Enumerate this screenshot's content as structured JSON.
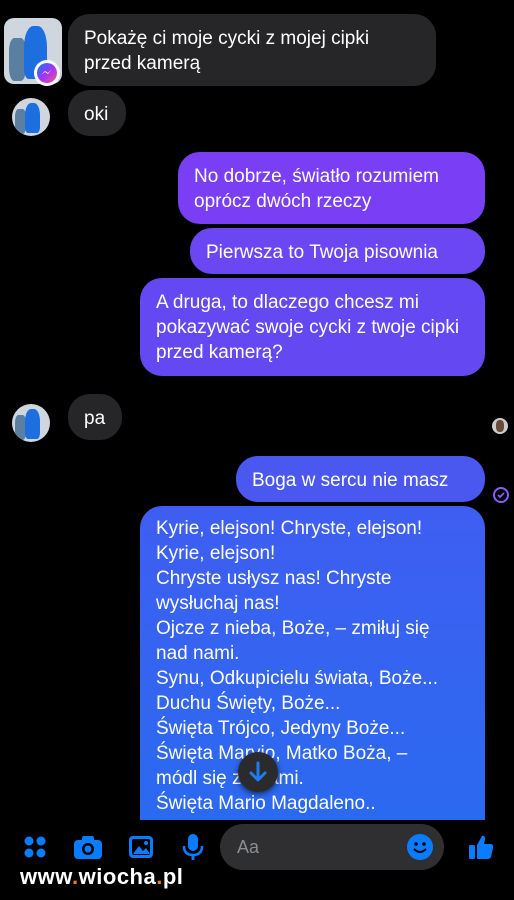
{
  "messages": {
    "m1": "Pokażę ci moje cycki z mojej cipki przed kamerą",
    "m2": "oki",
    "m3": "No dobrze, światło rozumiem oprócz dwóch rzeczy",
    "m4": "Pierwsza to Twoja pisownia",
    "m5": "A druga, to dlaczego chcesz mi pokazywać swoje cycki z twoje cipki przed kamerą?",
    "m6": "pa",
    "m7": "Boga w sercu nie masz",
    "m8_lines": [
      "Kyrie, elejson! Chryste, elejson!",
      "Kyrie, elejson!",
      "Chryste usłysz nas! Chryste",
      "wysłuchaj nas!",
      "Ojcze z nieba, Boże, – zmiłuj się",
      "nad nami.",
      "Synu, Odkupicielu świata, Boże...",
      "Duchu Święty, Boże...",
      "Święta Trójco, Jedyny Boże...",
      "Święta Maryio, Matko Boża, –",
      "módl się za nami.",
      "Święta Mario Magdaleno.."
    ]
  },
  "composer": {
    "placeholder": "Aa"
  },
  "icons": {
    "grid": "apps-icon",
    "camera": "camera-icon",
    "gallery": "gallery-icon",
    "mic": "microphone-icon",
    "emoji": "emoji-icon",
    "like": "thumbs-up-icon",
    "scroll": "arrow-down-icon"
  },
  "colors": {
    "accent": "#0a7cff",
    "outgoing_top": "#7b3ff5",
    "outgoing_bottom": "#1f6ef0",
    "incoming": "#262628"
  },
  "watermark": {
    "prefix": "www",
    "name": "wiocha",
    "suffix": "pl"
  }
}
